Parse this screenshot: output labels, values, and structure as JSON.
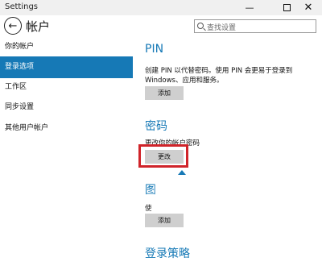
{
  "window": {
    "title": "Settings",
    "minimize": "—",
    "close": "✕"
  },
  "header": {
    "back": "←",
    "title": "帐户",
    "search_placeholder": "查找设置"
  },
  "sidebar": {
    "items": [
      {
        "label": "你的帐户"
      },
      {
        "label": "登录选项",
        "active": true
      },
      {
        "label": "工作区"
      },
      {
        "label": "同步设置"
      },
      {
        "label": "其他用户帐户"
      }
    ]
  },
  "main": {
    "pin": {
      "heading": "PIN",
      "desc": "创建 PIN 以代替密码。使用 PIN 会更易于登录到 Windows、应用和服务。",
      "button": "添加"
    },
    "password": {
      "heading": "密码",
      "desc": "更改你的帐户密码",
      "button": "更改"
    },
    "picture_password": {
      "heading": "图",
      "desc": "使",
      "button": "添加"
    },
    "login_policy": {
      "heading": "登录策略"
    }
  },
  "colors": {
    "accent": "#1679b6",
    "highlight": "#d0242a"
  }
}
